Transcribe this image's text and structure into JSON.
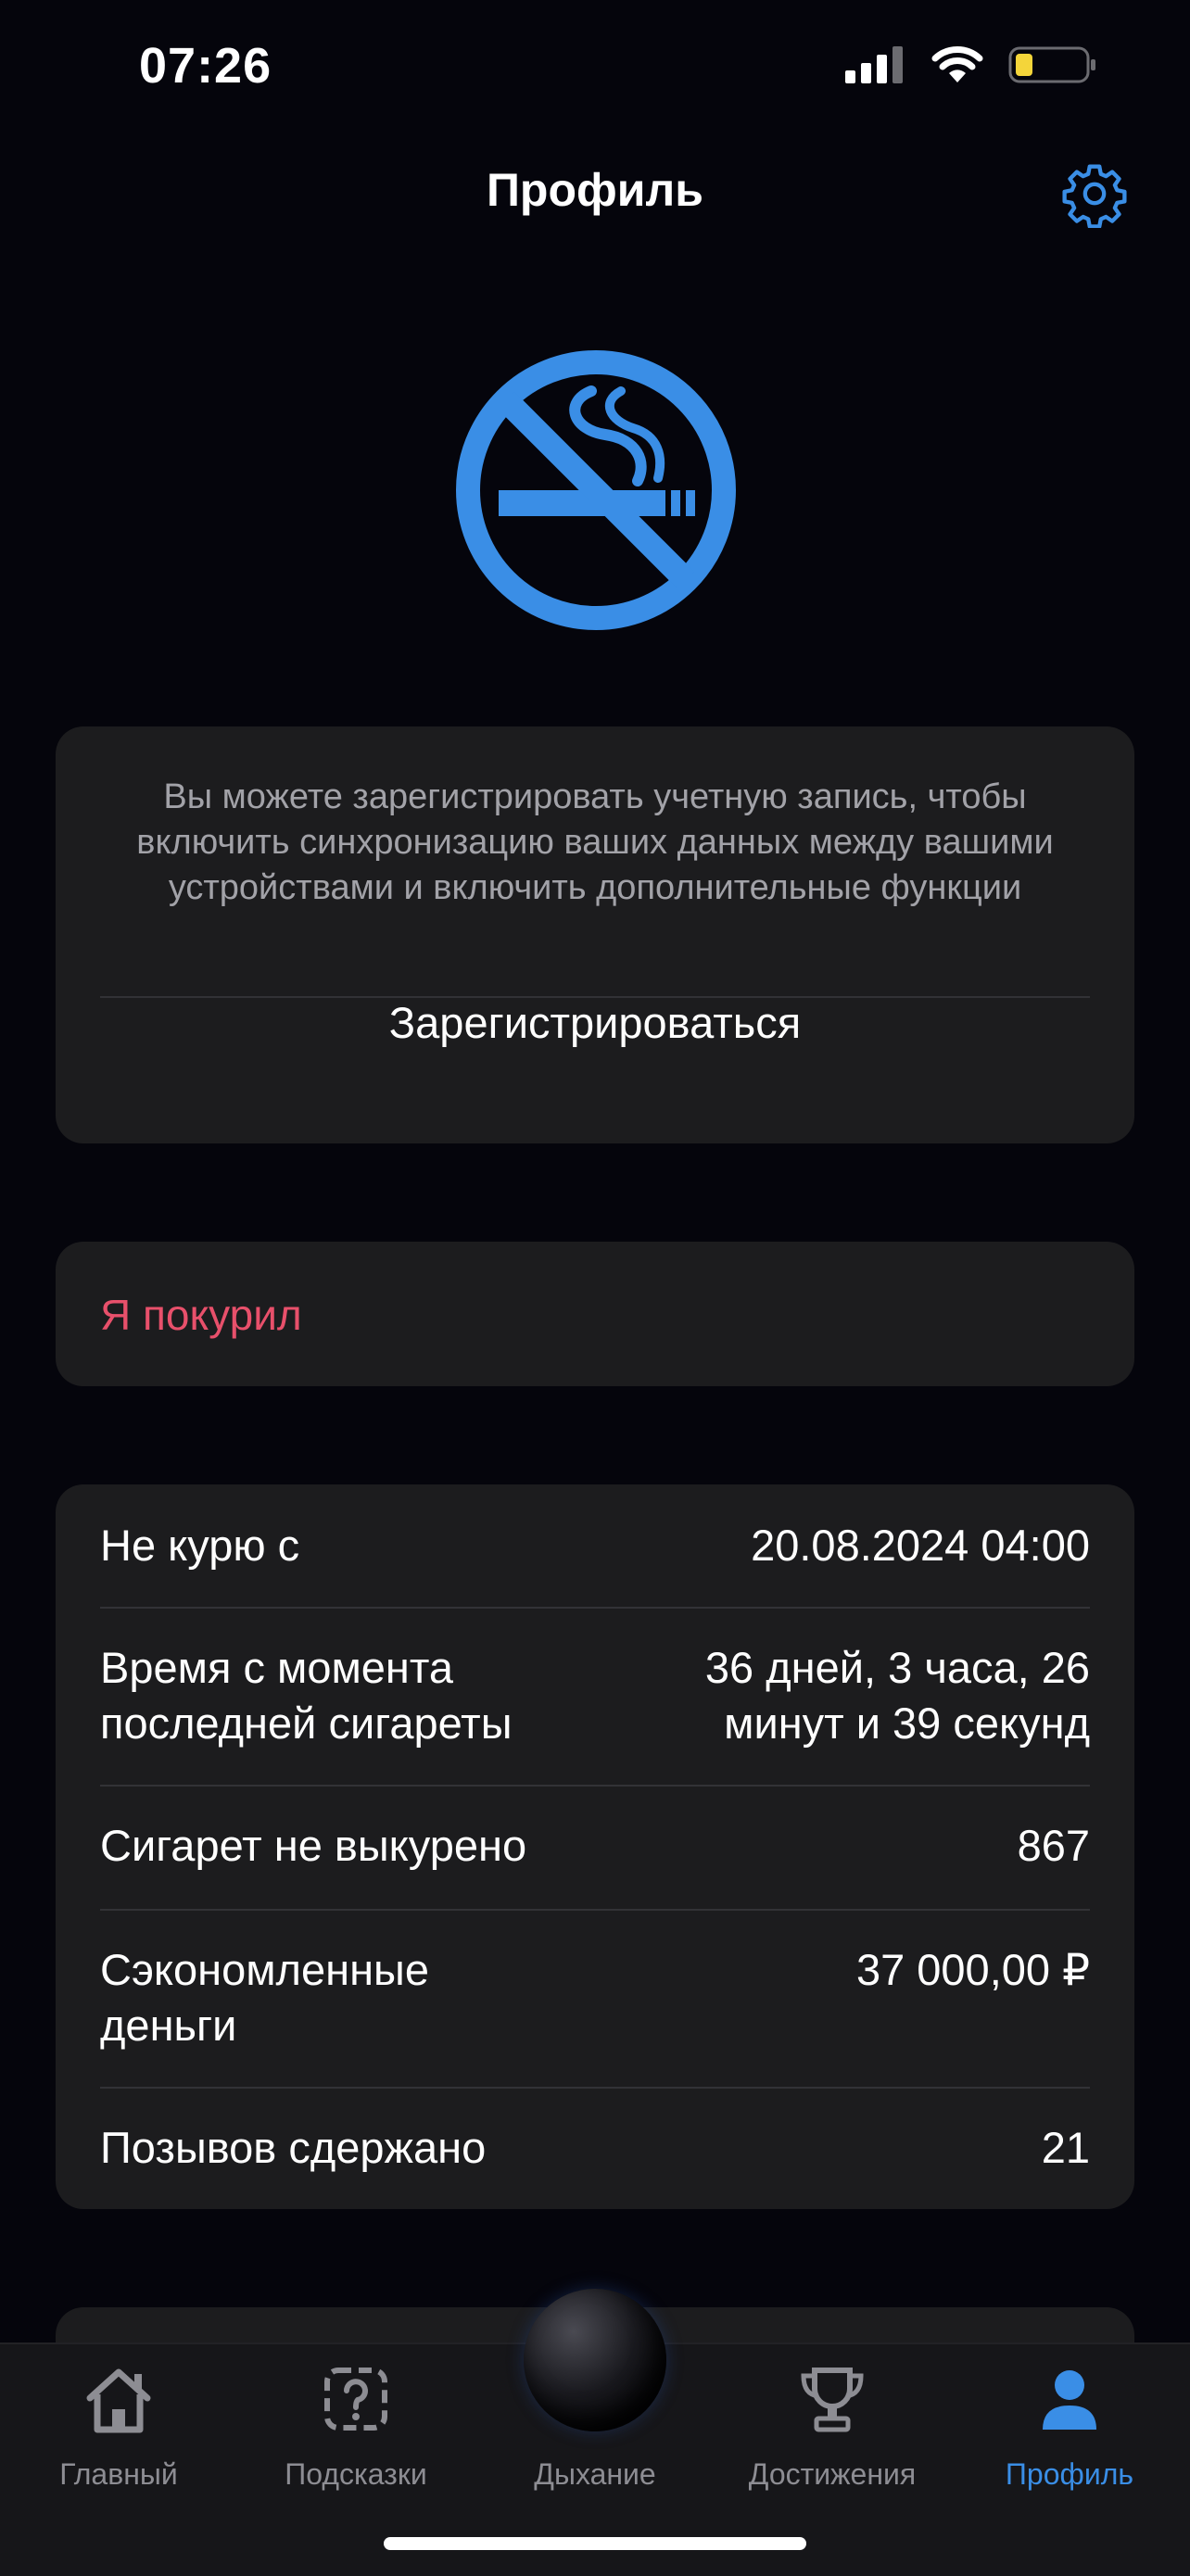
{
  "status_bar": {
    "time": "07:26",
    "battery_color": "#f4d53a"
  },
  "header": {
    "title": "Профиль",
    "settings_icon": "gear-icon"
  },
  "hero": {
    "icon": "no-smoking-icon",
    "color": "#3a8ee6"
  },
  "register_card": {
    "text": "Вы можете зарегистрировать учетную запись, чтобы включить синхронизацию ваших данных между вашими устройствами и включить дополнительные функции",
    "button": "Зарегистрироваться"
  },
  "smoked_card": {
    "button": "Я покурил",
    "color": "#e8506b"
  },
  "stats": [
    {
      "label": "Не курю с",
      "value": "20.08.2024 04:00"
    },
    {
      "label": "Время с момента последней сигареты",
      "value": "36 дней, 3 часа, 26 минут и 39 секунд"
    },
    {
      "label": "Сигарет не выкурено",
      "value": "867"
    },
    {
      "label": "Сэкономленные деньги",
      "value": "37 000,00 ₽"
    },
    {
      "label": "Позывов сдержано",
      "value": "21"
    }
  ],
  "tabs": [
    {
      "label": "Главный",
      "icon": "house-icon"
    },
    {
      "label": "Подсказки",
      "icon": "question-mark-icon"
    },
    {
      "label": "Дыхание",
      "icon": "breathing-orb"
    },
    {
      "label": "Достижения",
      "icon": "trophy-icon"
    },
    {
      "label": "Профиль",
      "icon": "person-icon",
      "active": true
    }
  ],
  "accent_color": "#3a8ee6"
}
